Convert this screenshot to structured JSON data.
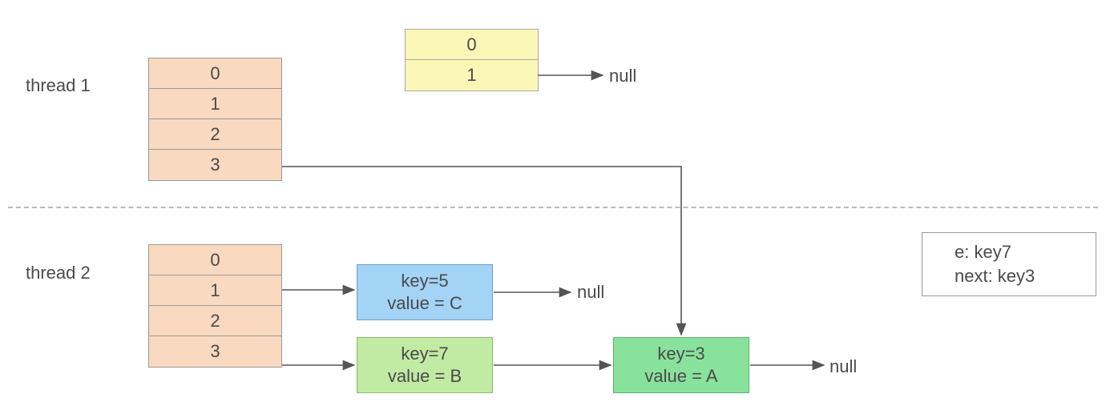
{
  "thread1": {
    "label": "thread 1",
    "table": [
      "0",
      "1",
      "2",
      "3"
    ],
    "newTable": [
      "0",
      "1"
    ],
    "null1": "null"
  },
  "thread2": {
    "label": "thread 2",
    "table": [
      "0",
      "1",
      "2",
      "3"
    ],
    "nodeC": {
      "key": "key=5",
      "value": "value = C"
    },
    "nodeB": {
      "key": "key=7",
      "value": "value = B"
    },
    "nodeA": {
      "key": "key=3",
      "value": "value = A"
    },
    "nullC": "null",
    "nullA": "null"
  },
  "state": {
    "e": "e:  key7",
    "next": "next:  key3"
  }
}
